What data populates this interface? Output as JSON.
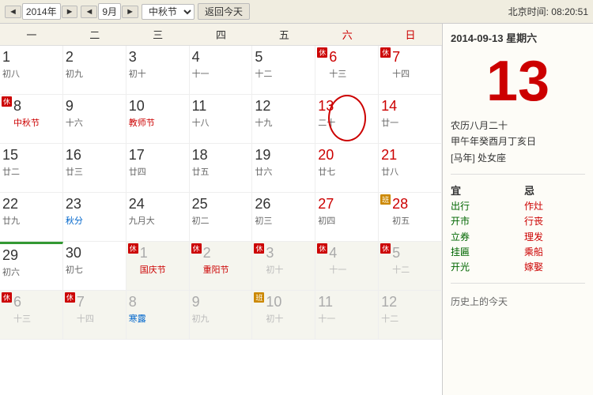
{
  "nav": {
    "prev_year_btn": "◄",
    "next_year_btn": "►",
    "prev_month_btn": "◄",
    "next_month_btn": "►",
    "year_label": "2014年",
    "month_label": "9月",
    "festival_label": "中秋节",
    "return_today": "返回今天",
    "beijing_time_label": "北京时间:",
    "beijing_time": "08:20:51"
  },
  "dow_headers": [
    "一",
    "二",
    "三",
    "四",
    "五",
    "六",
    "日"
  ],
  "selected_date": {
    "date_line": "2014-09-13  星期六",
    "big_day": "13",
    "lunar1": "农历八月二十",
    "lunar2": "甲午年癸酉月丁亥日",
    "lunar3": "[马年] 处女座",
    "yi_label": "宜",
    "ji_label": "忌",
    "yi_items": [
      "出行",
      "开市",
      "立券",
      "挂匾",
      "开光"
    ],
    "ji_items": [
      "作灶",
      "行丧",
      "理发",
      "乘船",
      "嫁娶"
    ],
    "history_label": "历史上的今天"
  },
  "weeks": [
    {
      "cells": [
        {
          "day": "1",
          "lunar": "初八",
          "badge": "",
          "festival": "",
          "solar_term": "",
          "weekend": false,
          "other": false,
          "next": false
        },
        {
          "day": "2",
          "lunar": "初九",
          "badge": "",
          "festival": "",
          "solar_term": "",
          "weekend": false,
          "other": false,
          "next": false
        },
        {
          "day": "3",
          "lunar": "初十",
          "badge": "",
          "festival": "",
          "solar_term": "",
          "weekend": false,
          "other": false,
          "next": false
        },
        {
          "day": "4",
          "lunar": "十一",
          "badge": "",
          "festival": "",
          "solar_term": "",
          "weekend": false,
          "other": false,
          "next": false
        },
        {
          "day": "5",
          "lunar": "十二",
          "badge": "",
          "festival": "",
          "solar_term": "",
          "weekend": false,
          "other": false,
          "next": false
        },
        {
          "day": "6",
          "lunar": "十三",
          "badge": "休",
          "festival": "",
          "solar_term": "",
          "weekend": true,
          "other": false,
          "next": false
        },
        {
          "day": "7",
          "lunar": "十四",
          "badge": "休",
          "festival": "",
          "solar_term": "",
          "weekend": true,
          "other": false,
          "next": false
        }
      ]
    },
    {
      "cells": [
        {
          "day": "8",
          "lunar": "中秋节",
          "badge": "休",
          "festival": "中秋节",
          "solar_term": "",
          "weekend": false,
          "other": false,
          "next": false
        },
        {
          "day": "9",
          "lunar": "十六",
          "badge": "",
          "festival": "",
          "solar_term": "",
          "weekend": false,
          "other": false,
          "next": false
        },
        {
          "day": "10",
          "lunar": "教师节",
          "badge": "",
          "festival": "教师节",
          "solar_term": "",
          "weekend": false,
          "other": false,
          "next": false
        },
        {
          "day": "11",
          "lunar": "十八",
          "badge": "",
          "festival": "",
          "solar_term": "",
          "weekend": false,
          "other": false,
          "next": false
        },
        {
          "day": "12",
          "lunar": "十九",
          "badge": "",
          "festival": "",
          "solar_term": "",
          "weekend": false,
          "other": false,
          "next": false
        },
        {
          "day": "13",
          "lunar": "二十",
          "badge": "",
          "festival": "",
          "solar_term": "",
          "weekend": true,
          "today": true,
          "other": false,
          "next": false
        },
        {
          "day": "14",
          "lunar": "廿一",
          "badge": "",
          "festival": "",
          "solar_term": "",
          "weekend": true,
          "other": false,
          "next": false
        }
      ]
    },
    {
      "cells": [
        {
          "day": "15",
          "lunar": "廿二",
          "badge": "",
          "festival": "",
          "solar_term": "",
          "weekend": false,
          "other": false,
          "next": false
        },
        {
          "day": "16",
          "lunar": "廿三",
          "badge": "",
          "festival": "",
          "solar_term": "",
          "weekend": false,
          "other": false,
          "next": false
        },
        {
          "day": "17",
          "lunar": "廿四",
          "badge": "",
          "festival": "",
          "solar_term": "",
          "weekend": false,
          "other": false,
          "next": false
        },
        {
          "day": "18",
          "lunar": "廿五",
          "badge": "",
          "festival": "",
          "solar_term": "",
          "weekend": false,
          "other": false,
          "next": false
        },
        {
          "day": "19",
          "lunar": "廿六",
          "badge": "",
          "festival": "",
          "solar_term": "",
          "weekend": false,
          "other": false,
          "next": false
        },
        {
          "day": "20",
          "lunar": "廿七",
          "badge": "",
          "festival": "",
          "solar_term": "",
          "weekend": true,
          "other": false,
          "next": false
        },
        {
          "day": "21",
          "lunar": "廿八",
          "badge": "",
          "festival": "",
          "solar_term": "",
          "weekend": true,
          "other": false,
          "next": false
        }
      ]
    },
    {
      "cells": [
        {
          "day": "22",
          "lunar": "廿九",
          "badge": "",
          "festival": "",
          "solar_term": "",
          "weekend": false,
          "other": false,
          "next": false
        },
        {
          "day": "23",
          "lunar": "秋分",
          "badge": "",
          "festival": "",
          "solar_term": "秋分",
          "weekend": false,
          "other": false,
          "next": false
        },
        {
          "day": "24",
          "lunar": "九月大",
          "badge": "",
          "festival": "",
          "solar_term": "",
          "weekend": false,
          "other": false,
          "next": false
        },
        {
          "day": "25",
          "lunar": "初二",
          "badge": "",
          "festival": "",
          "solar_term": "",
          "weekend": false,
          "other": false,
          "next": false
        },
        {
          "day": "26",
          "lunar": "初三",
          "badge": "",
          "festival": "",
          "solar_term": "",
          "weekend": false,
          "other": false,
          "next": false
        },
        {
          "day": "27",
          "lunar": "初四",
          "badge": "",
          "festival": "",
          "solar_term": "",
          "weekend": true,
          "other": false,
          "next": false
        },
        {
          "day": "28",
          "lunar": "初五",
          "badge": "班",
          "festival": "",
          "solar_term": "",
          "weekend": true,
          "other": false,
          "next": false
        }
      ]
    },
    {
      "next_month_start": true,
      "cells": [
        {
          "day": "29",
          "lunar": "初六",
          "badge": "",
          "festival": "",
          "solar_term": "",
          "weekend": false,
          "other": false,
          "next": false
        },
        {
          "day": "30",
          "lunar": "初七",
          "badge": "",
          "festival": "",
          "solar_term": "",
          "weekend": false,
          "other": false,
          "next": false
        },
        {
          "day": "1",
          "lunar": "国庆节",
          "badge": "休",
          "festival": "国庆节",
          "solar_term": "",
          "weekend": false,
          "other": false,
          "next": true
        },
        {
          "day": "2",
          "lunar": "重阳节",
          "badge": "休",
          "festival": "重阳节",
          "solar_term": "",
          "weekend": false,
          "other": false,
          "next": true
        },
        {
          "day": "3",
          "lunar": "初十",
          "badge": "休",
          "festival": "",
          "solar_term": "",
          "weekend": false,
          "other": false,
          "next": true
        },
        {
          "day": "4",
          "lunar": "十一",
          "badge": "休",
          "festival": "",
          "solar_term": "",
          "weekend": true,
          "other": false,
          "next": true
        },
        {
          "day": "5",
          "lunar": "十二",
          "badge": "休",
          "festival": "",
          "solar_term": "",
          "weekend": true,
          "other": false,
          "next": true
        }
      ]
    },
    {
      "cells": [
        {
          "day": "6",
          "lunar": "十三",
          "badge": "休",
          "festival": "",
          "solar_term": "",
          "weekend": false,
          "other": false,
          "next": true
        },
        {
          "day": "7",
          "lunar": "十四",
          "badge": "休",
          "festival": "",
          "solar_term": "",
          "weekend": false,
          "other": false,
          "next": true
        },
        {
          "day": "8",
          "lunar": "寒露",
          "badge": "",
          "festival": "",
          "solar_term": "寒露",
          "weekend": false,
          "other": false,
          "next": true
        },
        {
          "day": "9",
          "lunar": "初九",
          "badge": "",
          "festival": "",
          "solar_term": "",
          "weekend": false,
          "other": false,
          "next": true
        },
        {
          "day": "10",
          "lunar": "初十",
          "badge": "班",
          "festival": "",
          "solar_term": "",
          "weekend": false,
          "other": false,
          "next": true
        },
        {
          "day": "11",
          "lunar": "十一",
          "badge": "",
          "festival": "",
          "solar_term": "",
          "weekend": true,
          "other": false,
          "next": true
        },
        {
          "day": "12",
          "lunar": "十二",
          "badge": "",
          "festival": "",
          "solar_term": "",
          "weekend": true,
          "other": false,
          "next": true
        }
      ]
    }
  ]
}
